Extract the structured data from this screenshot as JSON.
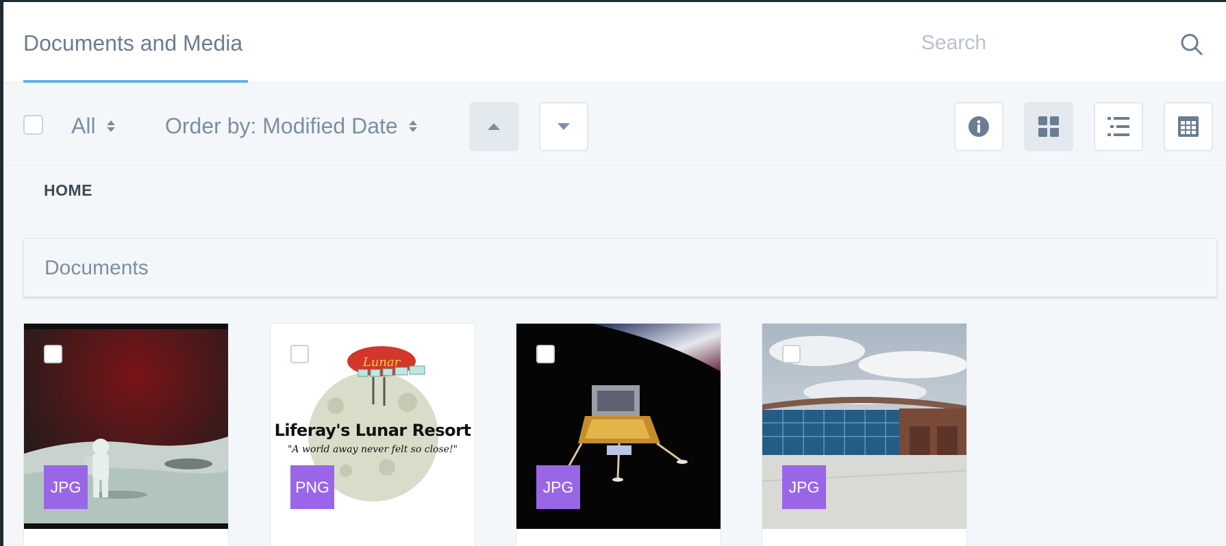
{
  "header": {
    "title": "Documents and Media",
    "search_placeholder": "Search"
  },
  "toolbar": {
    "filter_label": "All",
    "order_label": "Order by: Modified Date",
    "sort_active": "ascending",
    "display_style_active": "cards"
  },
  "breadcrumb": {
    "label": "HOME"
  },
  "section": {
    "title": "Documents"
  },
  "documents": [
    {
      "type": "JPG"
    },
    {
      "type": "PNG"
    },
    {
      "type": "JPG"
    },
    {
      "type": "JPG"
    }
  ],
  "colors": {
    "accent": "#65b0e6",
    "badge": "#9a66e8",
    "muted_text": "#7c8ea3"
  }
}
